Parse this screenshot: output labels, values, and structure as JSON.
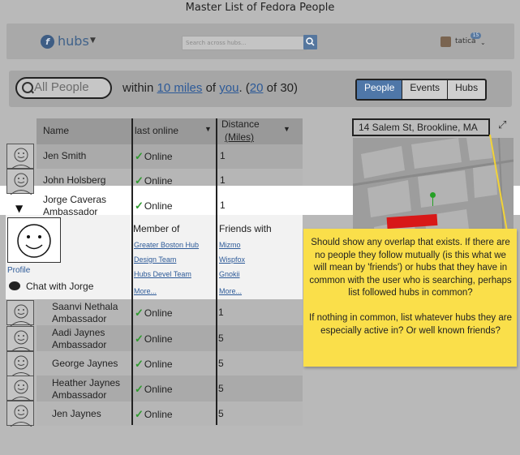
{
  "window": {
    "title": "Master List of Fedora People"
  },
  "header": {
    "logo_text": "hubs",
    "logo_letter": "f",
    "search_placeholder": "Search across hubs...",
    "user": {
      "name": "tatica",
      "notifications": "15"
    }
  },
  "filter": {
    "search_value": "All People",
    "prefix": "within",
    "distance": "10 miles",
    "of": "of",
    "anchor": "you",
    "count_open": ". (",
    "count_shown": "20",
    "count_total": "of 30)",
    "tabs": [
      {
        "label": "People",
        "active": true
      },
      {
        "label": "Events",
        "active": false
      },
      {
        "label": "Hubs",
        "active": false
      }
    ]
  },
  "table": {
    "columns": {
      "name": "Name",
      "last_online": "last online",
      "distance": "Distance",
      "distance_unit": "(Miles)"
    },
    "rows": [
      {
        "name": "Jen Smith",
        "name2": "",
        "status": "Online",
        "distance": "1"
      },
      {
        "name": "John Holsberg",
        "name2": "",
        "status": "Online",
        "distance": "1"
      },
      {
        "name": "Jorge Caveras",
        "name2": "Ambassador",
        "status": "Online",
        "distance": "1"
      },
      {
        "name": "Saanvi Nethala",
        "name2": "Ambassador",
        "status": "Online",
        "distance": "1"
      },
      {
        "name": "Aadi Jaynes",
        "name2": "Ambassador",
        "status": "Online",
        "distance": "5"
      },
      {
        "name": "George Jaynes",
        "name2": "",
        "status": "Online",
        "distance": "5"
      },
      {
        "name": "Heather Jaynes",
        "name2": "Ambassador",
        "status": "Online",
        "distance": "5"
      },
      {
        "name": "Jen Jaynes",
        "name2": "",
        "status": "Online",
        "distance": "5"
      }
    ]
  },
  "expanded": {
    "profile_label": "Profile",
    "chat_label": "Chat with Jorge",
    "member_of": {
      "heading": "Member of",
      "items": [
        "Greater Boston Hub",
        "Design Team",
        "Hubs Devel Team"
      ],
      "more": "More..."
    },
    "friends_with": {
      "heading": "Friends with",
      "items": [
        "Mizmo",
        "Wispfox",
        "Gnokii"
      ],
      "more": "More..."
    }
  },
  "map": {
    "address": "14 Salem St, Brookline, MA"
  },
  "note": {
    "text": "Should show any overlap that exists. If there are no people they follow mutually (is this what we will mean by 'friends') or hubs that they have in common with the user who is searching, perhaps list followed hubs in common?\n\nIf nothing in common, list whatever hubs they are especially active in? Or well known friends?"
  },
  "colors": {
    "accent": "#4f77a8",
    "link": "#2d5a98",
    "online": "#2f9a2f",
    "note": "#fadf4a",
    "marker": "#d81818"
  }
}
